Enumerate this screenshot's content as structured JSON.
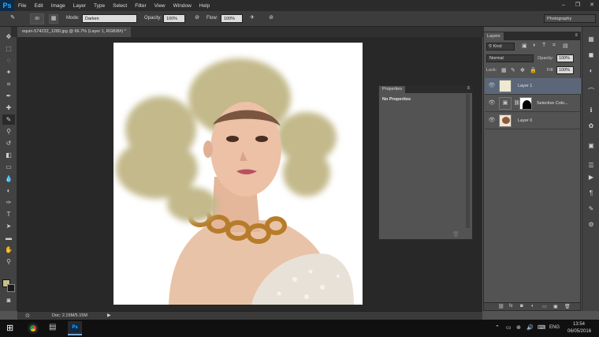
{
  "app": {
    "logo": "Ps"
  },
  "menubar": {
    "items": [
      "File",
      "Edit",
      "Image",
      "Layer",
      "Type",
      "Select",
      "Filter",
      "View",
      "Window",
      "Help"
    ]
  },
  "window_controls": [
    "–",
    "❐",
    "✕"
  ],
  "options": {
    "brush_size": "90",
    "mode_label": "Mode:",
    "mode_value": "Darken",
    "opacity_label": "Opacity:",
    "opacity_value": "100%",
    "flow_label": "Flow:",
    "flow_value": "100%",
    "workspace": "Photography"
  },
  "document": {
    "tab_title": "equin-574232_1280.jpg @ 66.7% (Layer 1, RGB/8#) *"
  },
  "status": {
    "doc_size": "Doc: 2.15M/5.15M"
  },
  "properties": {
    "tab": "Properties",
    "message": "No Properties"
  },
  "layers_panel": {
    "tab": "Layers",
    "kind": "Kind",
    "blend_mode": "Normal",
    "opacity_label": "Opacity:",
    "opacity_value": "100%",
    "lock_label": "Lock:",
    "fill_label": "Fill:",
    "fill_value": "100%",
    "layers": [
      {
        "name": "Layer 1",
        "selected": true
      },
      {
        "name": "Selective Colo...",
        "selected": false
      },
      {
        "name": "Layer 0",
        "selected": false
      }
    ]
  },
  "taskbar": {
    "lang": "ENG",
    "time": "13:54",
    "date": "06/05/2016"
  },
  "colors": {
    "foreground": "#c9bf8a",
    "background": "#1a1a1a",
    "paint": "#c3b98b"
  }
}
